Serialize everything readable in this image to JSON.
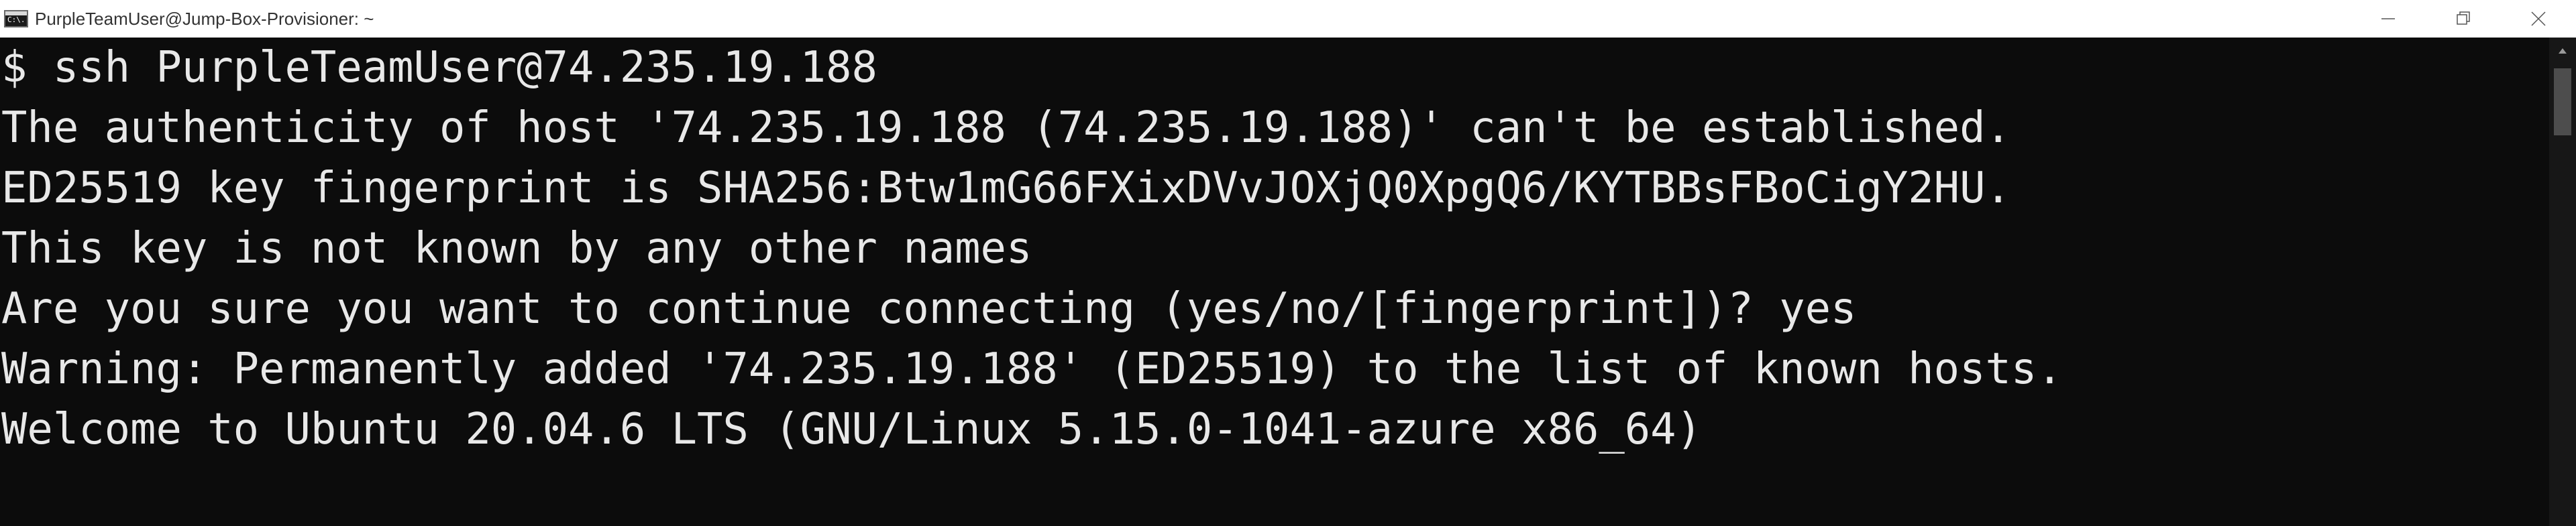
{
  "window": {
    "title": "PurpleTeamUser@Jump-Box-Provisioner: ~",
    "icon_text": "C:\\."
  },
  "controls": {
    "minimize_icon": "minimize-icon",
    "restore_icon": "restore-icon",
    "close_icon": "close-icon"
  },
  "console": {
    "lines": [
      "$ ssh PurpleTeamUser@74.235.19.188",
      "The authenticity of host '74.235.19.188 (74.235.19.188)' can't be established.",
      "ED25519 key fingerprint is SHA256:Btw1mG66FXixDVvJOXjQ0XpgQ6/KYTBBsFBoCigY2HU.",
      "This key is not known by any other names",
      "Are you sure you want to continue connecting (yes/no/[fingerprint])? yes",
      "Warning: Permanently added '74.235.19.188' (ED25519) to the list of known hosts.",
      "Welcome to Ubuntu 20.04.6 LTS (GNU/Linux 5.15.0-1041-azure x86_64)"
    ]
  },
  "colors": {
    "console_bg": "#0c0c0c",
    "console_fg": "#e8e8e8",
    "titlebar_bg": "#ffffff"
  }
}
